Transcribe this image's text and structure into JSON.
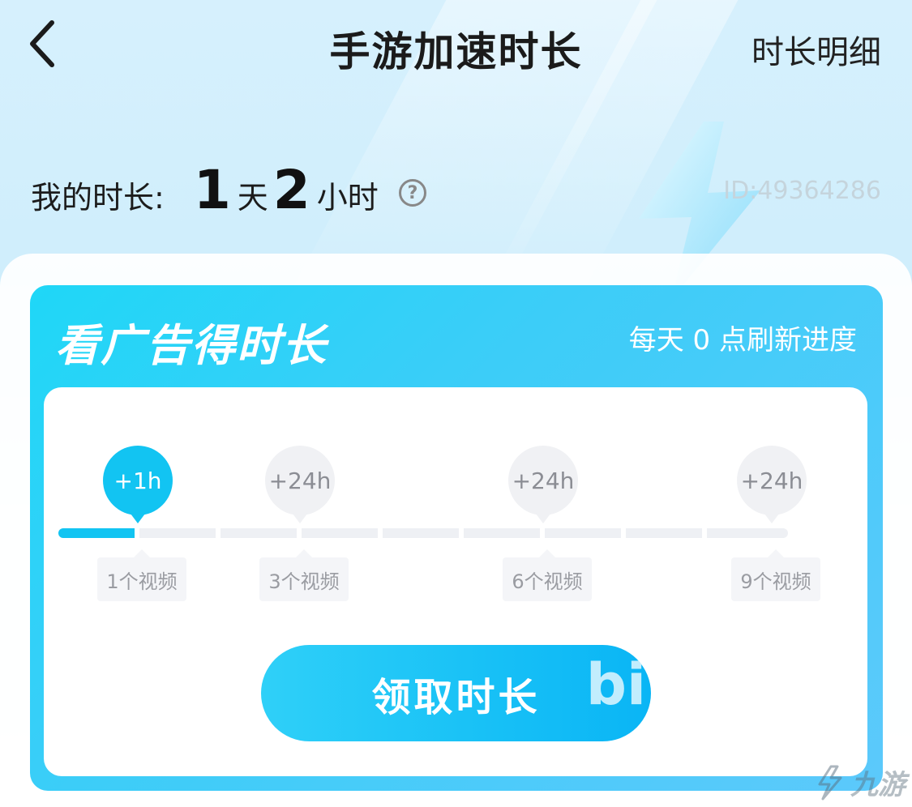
{
  "header": {
    "title": "手游加速时长",
    "detail_link": "时长明细"
  },
  "my_duration": {
    "label": "我的时长:",
    "days": "1",
    "days_unit": "天",
    "hours": "2",
    "hours_unit": "小时",
    "help_icon": "help-icon",
    "user_id": "ID:49364286"
  },
  "ad_card": {
    "title": "看广告得时长",
    "subtitle": "每天 0 点刷新进度",
    "progress_completed_segments": 1,
    "progress_total_segments": 9,
    "milestones": [
      {
        "reward": "+1h",
        "label": "1个视频",
        "active": true
      },
      {
        "reward": "+24h",
        "label": "3个视频",
        "active": false
      },
      {
        "reward": "+24h",
        "label": "6个视频",
        "active": false
      },
      {
        "reward": "+24h",
        "label": "9个视频",
        "active": false
      }
    ],
    "claim_button": "领取时长",
    "claim_button_deco": "bi"
  },
  "watermark": {
    "text": "九游",
    "icon": "jiuyou-logo-icon"
  },
  "colors": {
    "accent": "#12c4f2",
    "card_gradient_start": "#1fd7f7",
    "card_gradient_end": "#5cc9fb"
  }
}
